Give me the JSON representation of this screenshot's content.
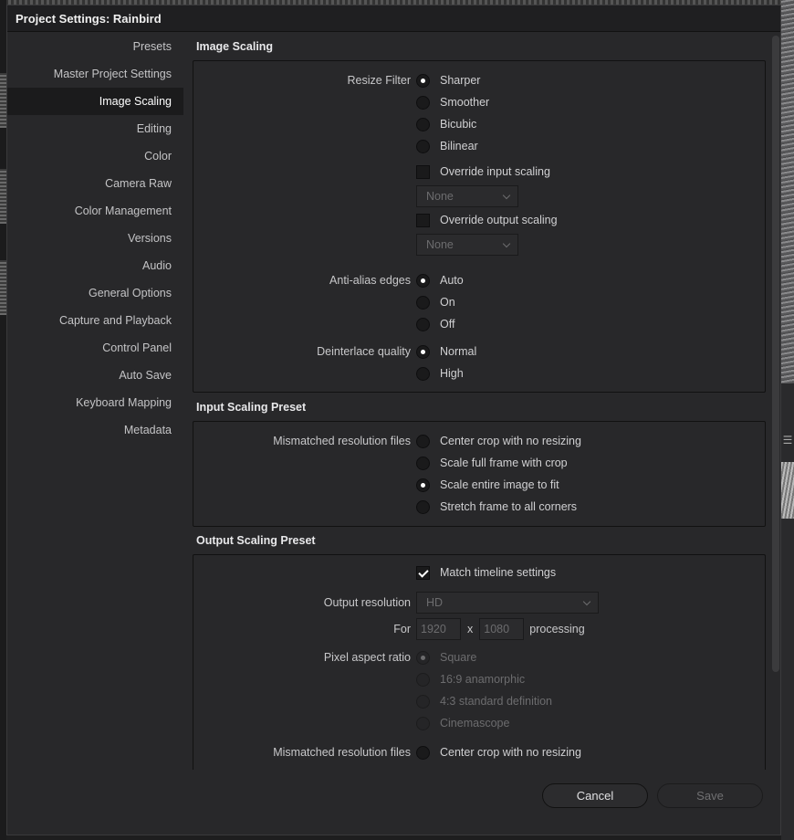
{
  "window": {
    "title": "Project Settings:  Rainbird"
  },
  "sidebar": {
    "items": [
      {
        "label": "Presets"
      },
      {
        "label": "Master Project Settings"
      },
      {
        "label": "Image Scaling"
      },
      {
        "label": "Editing"
      },
      {
        "label": "Color"
      },
      {
        "label": "Camera Raw"
      },
      {
        "label": "Color Management"
      },
      {
        "label": "Versions"
      },
      {
        "label": "Audio"
      },
      {
        "label": "General Options"
      },
      {
        "label": "Capture and Playback"
      },
      {
        "label": "Control Panel"
      },
      {
        "label": "Auto Save"
      },
      {
        "label": "Keyboard Mapping"
      },
      {
        "label": "Metadata"
      }
    ],
    "active": "Image Scaling"
  },
  "image_scaling": {
    "title": "Image Scaling",
    "resize_filter_label": "Resize Filter",
    "resize_filter_options": [
      "Sharper",
      "Smoother",
      "Bicubic",
      "Bilinear"
    ],
    "resize_filter_selected": "Sharper",
    "override_input_label": "Override input scaling",
    "override_input_value": "None",
    "override_output_label": "Override output scaling",
    "override_output_value": "None",
    "anti_alias_label": "Anti-alias edges",
    "anti_alias_options": [
      "Auto",
      "On",
      "Off"
    ],
    "anti_alias_selected": "Auto",
    "deinterlace_label": "Deinterlace quality",
    "deinterlace_options": [
      "Normal",
      "High"
    ],
    "deinterlace_selected": "Normal"
  },
  "input_scaling_preset": {
    "title": "Input Scaling Preset",
    "mismatched_label": "Mismatched resolution files",
    "options": [
      "Center crop with no resizing",
      "Scale full frame with crop",
      "Scale entire image to fit",
      "Stretch frame to all corners"
    ],
    "selected": "Scale entire image to fit"
  },
  "output_scaling_preset": {
    "title": "Output Scaling Preset",
    "match_timeline_label": "Match timeline settings",
    "match_timeline_checked": true,
    "output_resolution_label": "Output resolution",
    "output_resolution_value": "HD",
    "for_label": "For",
    "width": "1920",
    "x_label": "x",
    "height": "1080",
    "processing_label": "processing",
    "pixel_aspect_label": "Pixel aspect ratio",
    "pixel_aspect_options": [
      "Square",
      "16:9 anamorphic",
      "4:3 standard definition",
      "Cinemascope"
    ],
    "pixel_aspect_selected": "Square",
    "mismatched_label": "Mismatched resolution files",
    "mismatched_first_option": "Center crop with no resizing"
  },
  "footer": {
    "cancel_label": "Cancel",
    "save_label": "Save"
  },
  "background": {
    "menu_glyph": "☰"
  }
}
